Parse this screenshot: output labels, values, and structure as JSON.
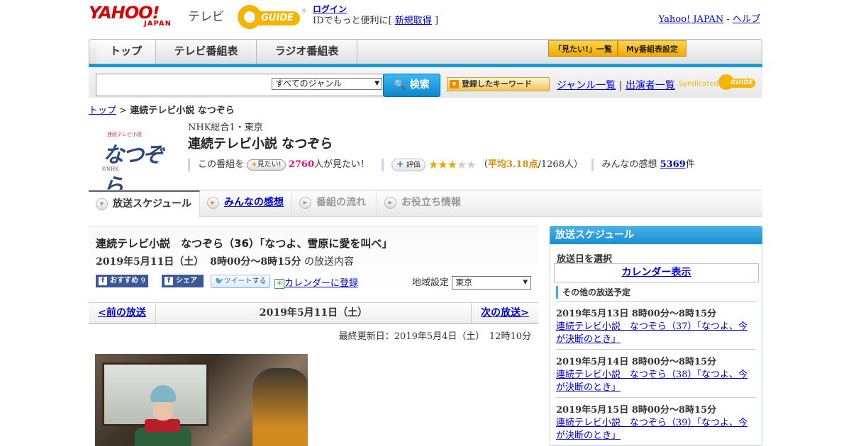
{
  "header": {
    "logo_yahoo": "YAHOO!",
    "logo_japan": "JAPAN",
    "logo_tv": "テレビ",
    "gguide_text": "GUIDE",
    "login_label": "ログイン",
    "login_prompt": "IDでもっと便利に[",
    "signup_label": "新規取得",
    "login_suffix": "]",
    "yahoo_japan_link": "Yahoo! JAPAN",
    "separator": "-",
    "help_link": "ヘルプ"
  },
  "nav": {
    "tabs": [
      {
        "label": "トップ"
      },
      {
        "label": "テレビ番組表"
      },
      {
        "label": "ラジオ番組表"
      }
    ],
    "mitai_list": "「見たい!」一覧",
    "my_schedule": "My番組表設定"
  },
  "search": {
    "input_value": "",
    "genre_selected": "すべてのジャンル",
    "search_button": "検索",
    "keyword_button": "登録したキーワード",
    "genre_list_link": "ジャンル一覧",
    "divider": "|",
    "performer_list_link": "出演者一覧",
    "syndicated": "Syndicated",
    "syndicated_logo": "GUIDE"
  },
  "breadcrumb": {
    "home": "トップ",
    "sep": ">",
    "current": "連続テレビ小説 なつぞら"
  },
  "program": {
    "logo_caption": "連続テレビ小説",
    "logo_title": "なつぞら",
    "logo_credit": "©NHK",
    "channel": "NHK総合1・東京",
    "title": "連続テレビ小説 なつぞら",
    "want_prefix": "この番組を",
    "want_button": "見たい!",
    "want_count": "2760",
    "want_suffix": "人が見たい！",
    "rate_button": "評価",
    "rating": 3.18,
    "rating_open": "（",
    "rating_avg_label": "平均3.18点",
    "rating_people": "/1268人）",
    "impressions_label": "みんなの感想",
    "impressions_count": "5369",
    "impressions_suffix": "件"
  },
  "subtabs": [
    {
      "label": "放送スケジュール"
    },
    {
      "label": "みんなの感想"
    },
    {
      "label": "番組の流れ"
    },
    {
      "label": "お役立ち情報"
    }
  ],
  "episode": {
    "title": "連続テレビ小説　なつぞら（36）「なつよ、雪原に愛を叫べ」",
    "date": "2019年5月11日（土）",
    "time": "8時00分～8時15分",
    "date_suffix": "の放送内容",
    "recommend_label": "おすすめ",
    "recommend_count": "9",
    "share_label": "シェア",
    "tweet_label": "ツイートする",
    "calendar_label": "カレンダーに登録",
    "region_label": "地域設定",
    "region_value": "東京",
    "prev_label": "<前の放送",
    "current_date": "2019年5月11日（土）",
    "next_label": "次の放送>",
    "updated": "最終更新日：2019年5月4日（土）　12時10分"
  },
  "sidebar": {
    "heading": "放送スケジュール",
    "select_date": "放送日を選択",
    "calendar_button": "カレンダー表示",
    "other_heading": "その他の放送予定",
    "items": [
      {
        "datetime": "2019年5月13日  8時00分～8時15分",
        "title": "連続テレビ小説　なつぞら（37）「なつよ、今が決断のとき」"
      },
      {
        "datetime": "2019年5月14日  8時00分～8時15分",
        "title": "連続テレビ小説　なつぞら（38）「なつよ、今が決断のとき」"
      },
      {
        "datetime": "2019年5月15日  8時00分～8時15分",
        "title": "連続テレビ小説　なつぞら（39）「なつよ、今が決断のとき」"
      }
    ]
  }
}
